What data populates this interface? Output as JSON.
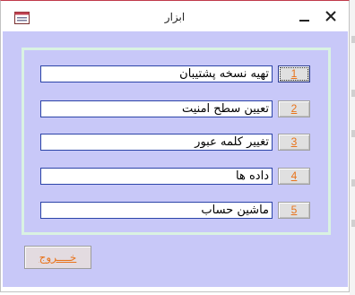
{
  "window": {
    "title": "ابزار",
    "icons": {
      "app": "form-icon",
      "minimize": "minimize-icon",
      "close": "close-icon"
    }
  },
  "rows": [
    {
      "number": "1",
      "label": "تهیه نسخه پشتیبان"
    },
    {
      "number": "2",
      "label": "تعیین سطح امنیت"
    },
    {
      "number": "3",
      "label": "تغییر کلمه عبور"
    },
    {
      "number": "4",
      "label": "داده ها"
    },
    {
      "number": "5",
      "label": "ماشین حساب"
    }
  ],
  "exit_label": "خــــروج",
  "colors": {
    "form_background": "#c8c8f8",
    "frame_border": "#d9f2e2",
    "field_border": "#2c44a8",
    "button_text": "#e8731a"
  }
}
